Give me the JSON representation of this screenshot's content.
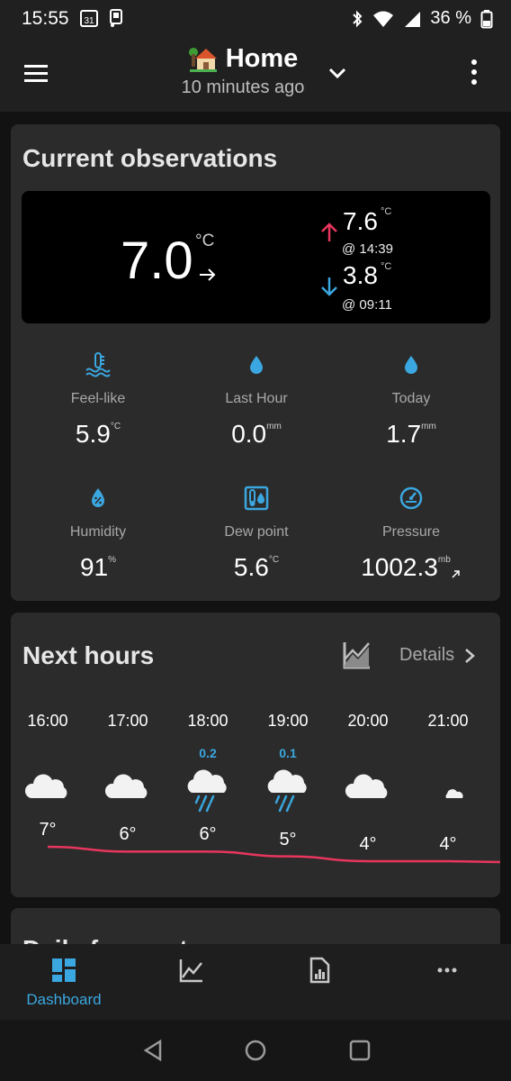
{
  "status_bar": {
    "time": "15:55",
    "calendar_badge": "31",
    "battery_percent": "36 %",
    "icons": [
      "calendar-icon",
      "sim-icon",
      "bluetooth-icon",
      "wifi-icon",
      "signal-icon",
      "battery-icon"
    ]
  },
  "app_bar": {
    "title": "Home",
    "subtitle": "10 minutes ago",
    "icons": [
      "menu-icon",
      "house-icon",
      "chevron-down-icon",
      "more-vert-icon"
    ]
  },
  "current": {
    "section_title": "Current observations",
    "temperature": "7.0",
    "temperature_unit": "°C",
    "max_temp": "7.6",
    "max_unit": "°C",
    "max_time": "@ 14:39",
    "min_temp": "3.8",
    "min_unit": "°C",
    "min_time": "@ 09:11",
    "stats": [
      {
        "label": "Feel-like",
        "value": "5.9",
        "unit": "°C",
        "icon": "thermometer-water-icon"
      },
      {
        "label": "Last Hour",
        "value": "0.0",
        "unit": "mm",
        "icon": "raindrop-icon"
      },
      {
        "label": "Today",
        "value": "1.7",
        "unit": "mm",
        "icon": "raindrop-icon"
      },
      {
        "label": "Humidity",
        "value": "91",
        "unit": "%",
        "icon": "humidity-icon"
      },
      {
        "label": "Dew point",
        "value": "5.6",
        "unit": "°C",
        "icon": "dew-point-icon"
      },
      {
        "label": "Pressure",
        "value": "1002.3",
        "unit": "mb",
        "icon": "gauge-icon"
      }
    ]
  },
  "next_hours": {
    "section_title": "Next hours",
    "details_label": "Details",
    "hours": [
      {
        "time": "16:00",
        "precip": "",
        "icon": "cloud-icon",
        "temp": "7°",
        "temp_value": 7
      },
      {
        "time": "17:00",
        "precip": "",
        "icon": "cloud-icon",
        "temp": "6°",
        "temp_value": 6
      },
      {
        "time": "18:00",
        "precip": "0.2",
        "icon": "cloud-rain-icon",
        "temp": "6°",
        "temp_value": 6
      },
      {
        "time": "19:00",
        "precip": "0.1",
        "icon": "cloud-rain-icon",
        "temp": "5°",
        "temp_value": 5
      },
      {
        "time": "20:00",
        "precip": "",
        "icon": "cloud-icon",
        "temp": "4°",
        "temp_value": 4
      },
      {
        "time": "21:00",
        "precip": "",
        "icon": "moon-cloud-icon",
        "temp": "4°",
        "temp_value": 4
      }
    ],
    "line_color": "#e8365d"
  },
  "daily": {
    "section_title": "Daily forecast"
  },
  "bottom_nav": {
    "items": [
      {
        "label": "Dashboard",
        "icon": "dashboard-icon",
        "active": true
      },
      {
        "label": "",
        "icon": "chart-icon",
        "active": false
      },
      {
        "label": "",
        "icon": "report-icon",
        "active": false
      },
      {
        "label": "",
        "icon": "more-horiz-icon",
        "active": false
      }
    ]
  },
  "colors": {
    "accent": "#3ba7e0",
    "max_arrow": "#e8365d",
    "min_arrow": "#3ba7e0"
  }
}
